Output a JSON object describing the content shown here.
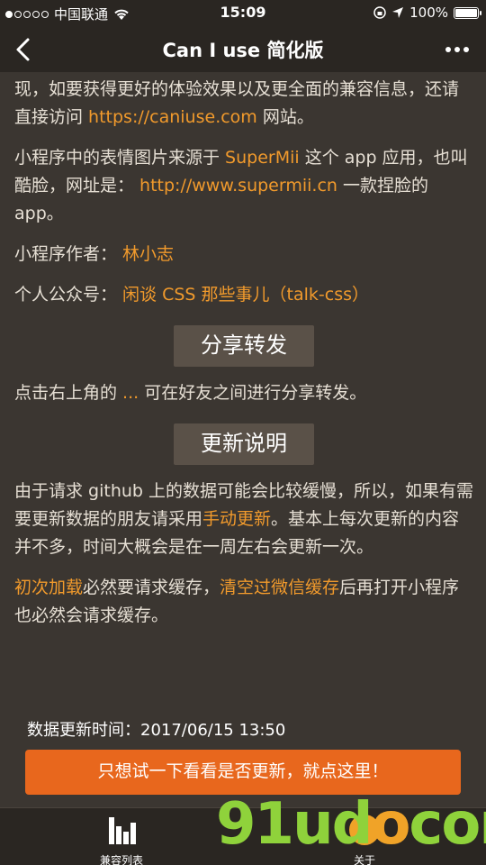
{
  "status_bar": {
    "carrier": "中国联通",
    "time": "15:09",
    "battery": "100%",
    "battery_fraction": 1.0
  },
  "nav": {
    "title": "Can I use 简化版"
  },
  "content": {
    "p1_text_a": "现，如要获得更好的体验效果以及更全面的兼容信息，还请直接访问 ",
    "p1_link": "https://caniuse.com",
    "p1_text_b": " 网站。",
    "p2_text_a": "小程序中的表情图片来源于 ",
    "p2_link1": "SuperMii",
    "p2_text_b": " 这个 app 应用，也叫酷脸，网址是： ",
    "p2_link2": "http://www.supermii.cn",
    "p2_text_c": " 一款捏脸的 app。",
    "author_label": "小程序作者： ",
    "author_value": "林小志",
    "wechat_label": "个人公众号： ",
    "wechat_value": "闲谈 CSS 那些事儿（talk-css）",
    "share_button": "分享转发",
    "share_text_a": "点击右上角的 ",
    "share_link": "...",
    "share_text_b": " 可在好友之间进行分享转发。",
    "update_button": "更新说明",
    "update_text_a": "由于请求 github 上的数据可能会比较缓慢，所以，如果有需要更新数据的朋友请采用",
    "update_link": "手动更新",
    "update_text_b": "。基本上每次更新的内容并不多，时间大概会是在一周左右会更新一次。",
    "cache_link1": "初次加载",
    "cache_text_a": "必然要请求缓存，",
    "cache_link2": "清空过微信缓存",
    "cache_text_b": "后再打开小程序也必然会请求缓存。"
  },
  "update_time": "数据更新时间：2017/06/15 13:50",
  "cta": "只想试一下看看是否更新，就点这里！",
  "tabs": {
    "compat": "兼容列表",
    "about": "关于"
  },
  "watermark": {
    "text_a": "91ud",
    "text_o": "o",
    "text_b": "com"
  },
  "colors": {
    "link": "#f19a2c",
    "cta": "#e8671d",
    "background": "#3b3631"
  }
}
